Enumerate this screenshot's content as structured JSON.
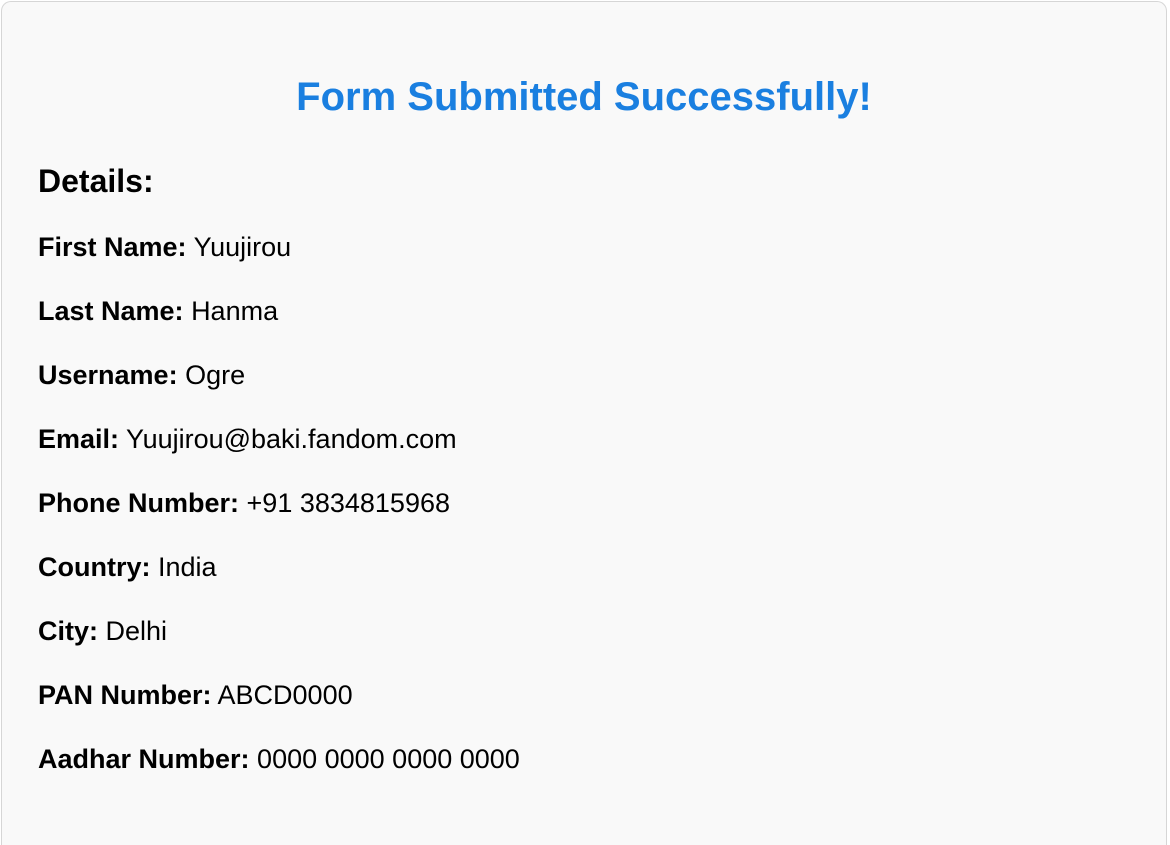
{
  "title": "Form Submitted Successfully!",
  "details_heading": "Details:",
  "fields": [
    {
      "label": "First Name:",
      "value": "Yuujirou"
    },
    {
      "label": "Last Name:",
      "value": "Hanma"
    },
    {
      "label": "Username:",
      "value": "Ogre"
    },
    {
      "label": "Email:",
      "value": "Yuujirou@baki.fandom.com"
    },
    {
      "label": "Phone Number:",
      "value": "+91 3834815968"
    },
    {
      "label": "Country:",
      "value": "India"
    },
    {
      "label": "City:",
      "value": "Delhi"
    },
    {
      "label": "PAN Number:",
      "value": "ABCD0000"
    },
    {
      "label": "Aadhar Number:",
      "value": "0000 0000 0000 0000"
    }
  ],
  "colors": {
    "title": "#1a7fe0",
    "card_background": "#f9f9f9",
    "text": "#000000"
  }
}
